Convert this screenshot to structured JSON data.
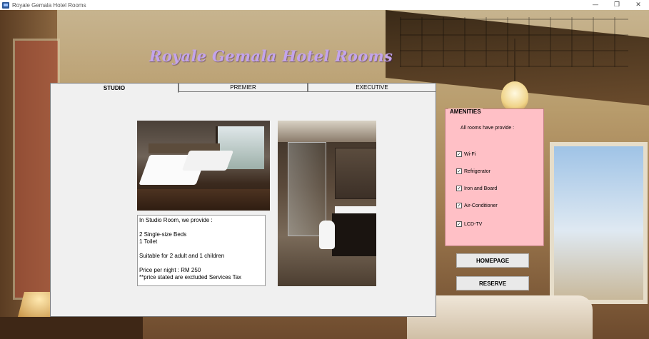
{
  "window": {
    "title": "Royale Gemala Hotel Rooms",
    "controls": {
      "minimize": "—",
      "restore": "❐",
      "close": "✕"
    }
  },
  "heading": "Royale Gemala Hotel Rooms",
  "tabs": [
    {
      "label": "STUDIO",
      "active": true
    },
    {
      "label": "PREMIER",
      "active": false
    },
    {
      "label": "EXECUTIVE",
      "active": false
    }
  ],
  "description": {
    "lines": [
      "In Studio Room, we provide :",
      "",
      "2 Single-size Beds",
      "1 Toilet",
      "",
      "Suitable for 2 adult and 1 children",
      "",
      "Price per night : RM 250",
      "**price stated are excluded Services Tax"
    ]
  },
  "amenities": {
    "title": "AMENITIES",
    "note": "All rooms have provide :",
    "items": [
      {
        "label": "Wi-Fi",
        "checked": true
      },
      {
        "label": "Refrigerator",
        "checked": true
      },
      {
        "label": "Iron and Board",
        "checked": true
      },
      {
        "label": "Air-Conditioner",
        "checked": true
      },
      {
        "label": "LCD-TV",
        "checked": true
      }
    ]
  },
  "buttons": {
    "homepage": "HOMEPAGE",
    "reserve": "RESERVE"
  },
  "colors": {
    "heading": "#c3a4ec",
    "amenities_bg": "#ffc0c6"
  }
}
